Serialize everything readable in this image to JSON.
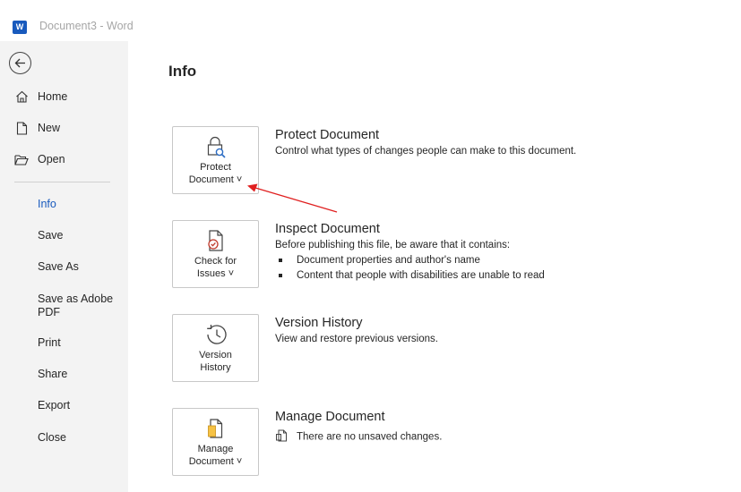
{
  "window": {
    "title": "Document3  -  Word",
    "logo_letter": "W"
  },
  "sidebar": {
    "top_items": [
      {
        "label": "Home"
      },
      {
        "label": "New"
      },
      {
        "label": "Open"
      }
    ],
    "sub_items": [
      {
        "label": "Info",
        "active": true
      },
      {
        "label": "Save"
      },
      {
        "label": "Save As"
      },
      {
        "label": "Save as Adobe PDF"
      },
      {
        "label": "Print"
      },
      {
        "label": "Share"
      },
      {
        "label": "Export"
      },
      {
        "label": "Close"
      }
    ]
  },
  "main": {
    "title": "Info",
    "sections": [
      {
        "button_label_1": "Protect",
        "button_label_2": "Document ˅",
        "title": "Protect Document",
        "desc": "Control what types of changes people can make to this document."
      },
      {
        "button_label_1": "Check for",
        "button_label_2": "Issues ˅",
        "title": "Inspect Document",
        "desc": "Before publishing this file, be aware that it contains:",
        "bullets": [
          "Document properties and author's name",
          "Content that people with disabilities are unable to read"
        ]
      },
      {
        "button_label_1": "Version",
        "button_label_2": "History",
        "title": "Version History",
        "desc": "View and restore previous versions."
      },
      {
        "button_label_1": "Manage",
        "button_label_2": "Document ˅",
        "title": "Manage Document",
        "desc": "There are no unsaved changes."
      }
    ]
  },
  "colors": {
    "accent": "#185abd",
    "annotation": "#e02020",
    "sidebar_bg": "#f3f3f3"
  }
}
